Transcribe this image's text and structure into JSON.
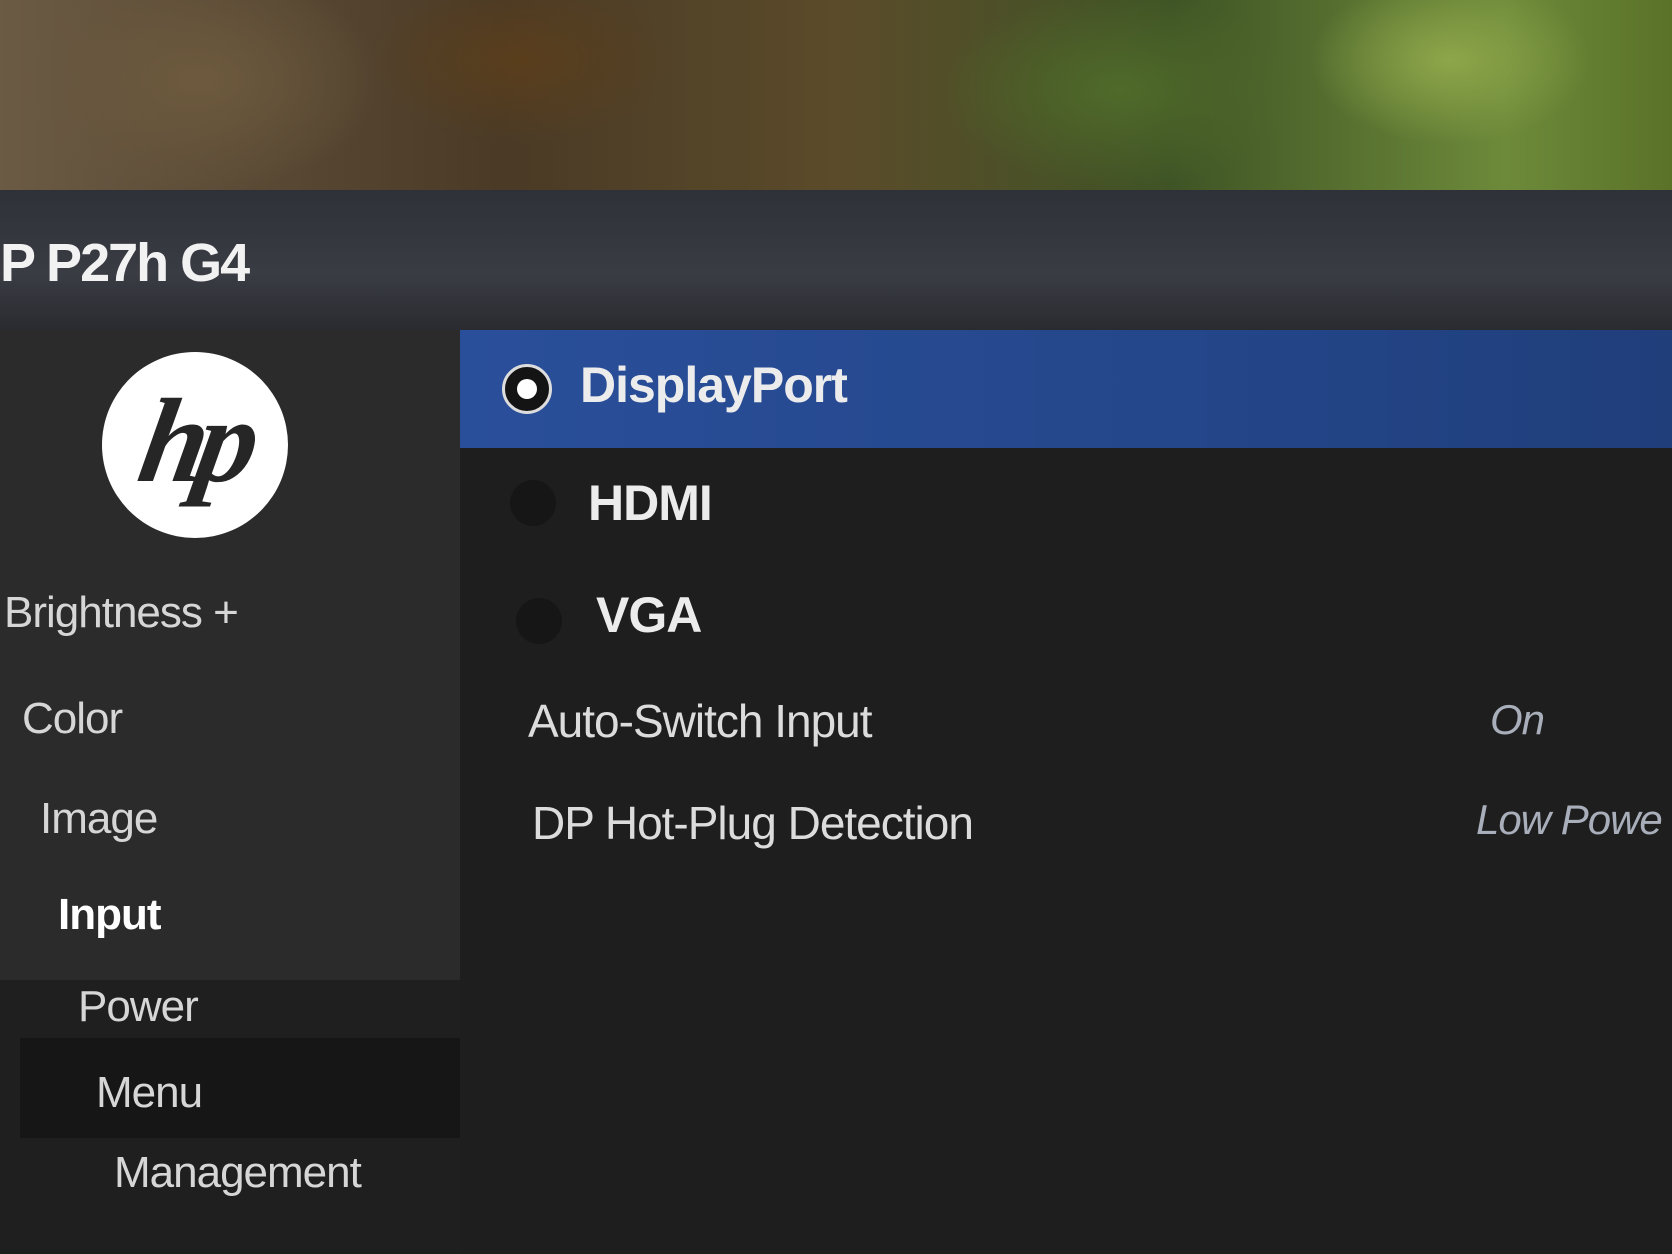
{
  "osd": {
    "model": "P P27h G4",
    "brand_logo": "hp"
  },
  "sidebar": {
    "items": [
      {
        "label": "Brightness +",
        "active": false
      },
      {
        "label": "Color",
        "active": false
      },
      {
        "label": "Image",
        "active": false
      },
      {
        "label": "Input",
        "active": true
      },
      {
        "label": "Power",
        "active": false
      },
      {
        "label": "Menu",
        "active": false
      },
      {
        "label": "Management",
        "active": false
      }
    ]
  },
  "input": {
    "options": [
      {
        "label": "DisplayPort",
        "selected": true
      },
      {
        "label": "HDMI",
        "selected": false
      },
      {
        "label": "VGA",
        "selected": false
      }
    ],
    "settings": [
      {
        "label": "Auto-Switch Input",
        "value": "On"
      },
      {
        "label": "DP Hot-Plug Detection",
        "value": "Low Powe"
      }
    ]
  },
  "colors": {
    "selection": "#2a4f9a",
    "panel": "#1e1e1e",
    "sidebar": "#2b2b2b"
  }
}
